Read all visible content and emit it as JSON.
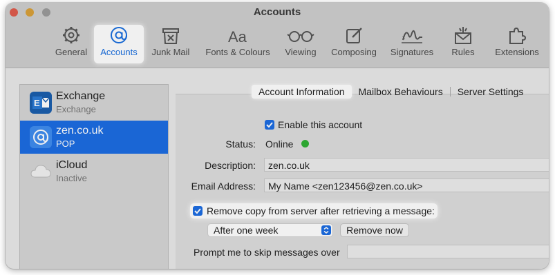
{
  "window": {
    "title": "Accounts"
  },
  "toolbar": {
    "items": [
      {
        "label": "General",
        "icon": "gear-icon"
      },
      {
        "label": "Accounts",
        "icon": "at-sign-icon",
        "active": true
      },
      {
        "label": "Junk Mail",
        "icon": "junk-bin-icon"
      },
      {
        "label": "Fonts & Colours",
        "icon": "font-icon"
      },
      {
        "label": "Viewing",
        "icon": "glasses-icon"
      },
      {
        "label": "Composing",
        "icon": "compose-icon"
      },
      {
        "label": "Signatures",
        "icon": "signature-icon"
      },
      {
        "label": "Rules",
        "icon": "rules-icon"
      },
      {
        "label": "Extensions",
        "icon": "puzzle-icon"
      }
    ]
  },
  "sidebar": {
    "accounts": [
      {
        "name": "Exchange",
        "type": "Exchange",
        "icon": "exchange-icon"
      },
      {
        "name": "zen.co.uk",
        "type": "POP",
        "icon": "at-sign-icon",
        "selected": true
      },
      {
        "name": "iCloud",
        "type": "Inactive",
        "icon": "cloud-icon"
      }
    ]
  },
  "tabs": {
    "account_information": "Account Information",
    "mailbox_behaviours": "Mailbox Behaviours",
    "server_settings": "Server Settings"
  },
  "form": {
    "enable_account": "Enable this account",
    "status_label": "Status:",
    "status_value": "Online",
    "description_label": "Description:",
    "description_value": "zen.co.uk",
    "email_label": "Email Address:",
    "email_value": "My Name <zen123456@zen.co.uk>",
    "remove_copy": "Remove copy from server after retrieving a message:",
    "remove_after": "After one week",
    "remove_now": "Remove now",
    "prompt_skip": "Prompt me to skip messages over"
  },
  "colors": {
    "accent": "#1c6de3",
    "status_online": "#2fb135"
  }
}
